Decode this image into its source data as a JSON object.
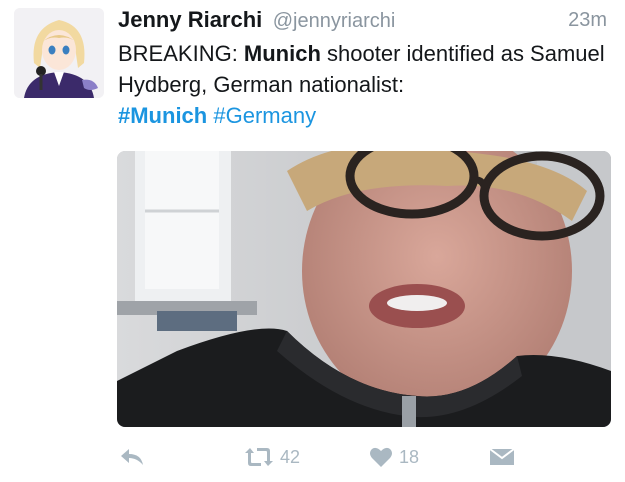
{
  "tweet": {
    "author_name": "Jenny Riarchi",
    "author_handle": "@jennyriarchi",
    "timestamp": "23m",
    "text": {
      "prefix": "BREAKING: ",
      "bold_word": "Munich",
      "rest": " shooter identified as Samuel Hydberg, German nationalist:",
      "hashtag1": "#Munich",
      "hashtag2": "#Germany"
    }
  },
  "actions": {
    "retweet_count": "42",
    "like_count": "18",
    "icons": [
      "reply-icon",
      "retweet-icon",
      "like-icon",
      "direct-message-icon"
    ],
    "icon_color": "#aab8c2"
  },
  "colors": {
    "link": "#1b95e0",
    "muted": "#8a959f"
  }
}
